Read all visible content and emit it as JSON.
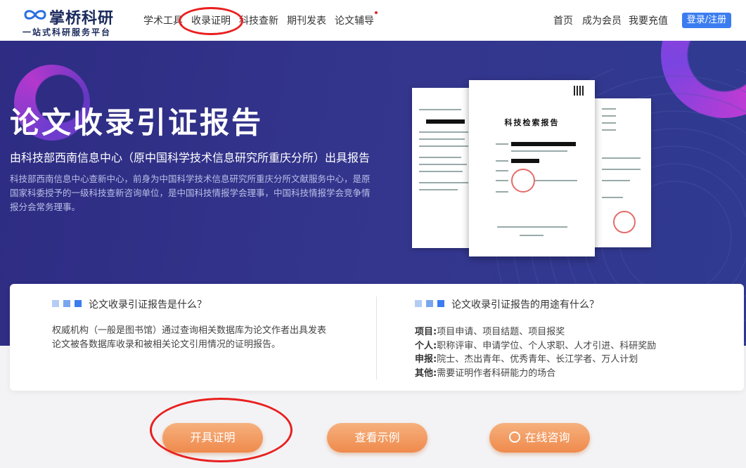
{
  "brand": {
    "title": "掌桥科研",
    "subtitle": "一站式科研服务平台"
  },
  "nav": {
    "items": [
      "学术工具",
      "收录证明",
      "科技查新",
      "期刊发表",
      "论文辅导"
    ],
    "right": [
      "首页",
      "成为会员",
      "我要充值"
    ],
    "login": "登录/注册"
  },
  "hero": {
    "title": "论文收录引证报告",
    "subtitle": "由科技部西南信息中心（原中国科学技术信息研究所重庆分所）出具报告",
    "desc": "科技部西南信息中心查新中心，前身为中国科学技术信息研究所重庆分所文献服务中心，是原国家科委授予的一级科技查新咨询单位，是中国科技情报学会理事，中国科技情报学会竞争情报分会常务理事。"
  },
  "doc": {
    "heading": "科技检索报告"
  },
  "card": {
    "what_title": "论文收录引证报告是什么？",
    "what_desc": "权威机构（一般是图书馆）通过查询相关数据库为论文作者出具发表论文被各数据库收录和被相关论文引用情况的证明报告。",
    "use_title": "论文收录引证报告的用途有什么？",
    "uses": [
      {
        "label": "项目:",
        "text": "项目申请、项目结题、项目报奖"
      },
      {
        "label": "个人:",
        "text": "职称评审、申请学位、个人求职、人才引进、科研奖励"
      },
      {
        "label": "申报:",
        "text": "院士、杰出青年、优秀青年、长江学者、万人计划"
      },
      {
        "label": "其他:",
        "text": "需要证明作者科研能力的场合"
      }
    ]
  },
  "actions": {
    "issue": "开具证明",
    "example": "查看示例",
    "consult": "在线咨询"
  },
  "colors": {
    "accent": "#3b7df0",
    "hero_bg": "#2e2c83",
    "button": "#ef8a4c",
    "annotation": "#e8201f"
  }
}
